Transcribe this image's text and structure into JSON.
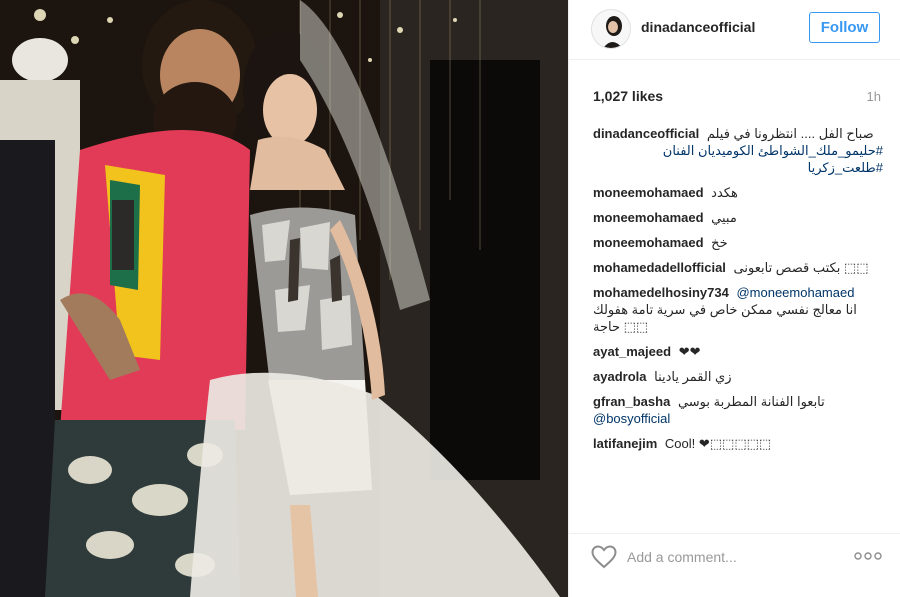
{
  "post": {
    "username": "dinadanceofficial",
    "follow_label": "Follow",
    "likes": "1,027 likes",
    "time": "1h",
    "add_comment_placeholder": "Add a comment...",
    "icons": {
      "avatar": "profile-avatar",
      "like": "heart-icon",
      "more": "more-options-icon"
    },
    "colors": {
      "accent": "#3897f0",
      "link": "#003569",
      "muted": "#999999"
    }
  },
  "comments": [
    {
      "user": "dinadanceofficial",
      "text": "صباح الفل .... انتظرونا في فيلم",
      "text2": "#حليمو_ملك_الشواطئ الكوميديان الفنان #طلعت_زكريا"
    },
    {
      "user": "moneemohamaed",
      "text": "هكدد"
    },
    {
      "user": "moneemohamaed",
      "text": "مبيي"
    },
    {
      "user": "moneemohamaed",
      "text": "خخ"
    },
    {
      "user": "mohamedadellofficial",
      "text": "بكتب قصص تابعونى ⬚⬚"
    },
    {
      "user": "mohamedelhosiny734",
      "mention": "@moneemohamaed",
      "text2": "انا معالج نفسي ممكن خاص في سرية تامة هفولك حاجة ⬚⬚"
    },
    {
      "user": "ayat_majeed",
      "text": "❤❤"
    },
    {
      "user": "ayadrola",
      "text": "زي القمر يادينا"
    },
    {
      "user": "gfran_basha",
      "text": "تابعوا الفنانة المطربة بوسي",
      "mention2": "@bosyofficial"
    },
    {
      "user": "latifanejim",
      "text": "Cool! ❤⬚⬚⬚⬚⬚"
    }
  ]
}
